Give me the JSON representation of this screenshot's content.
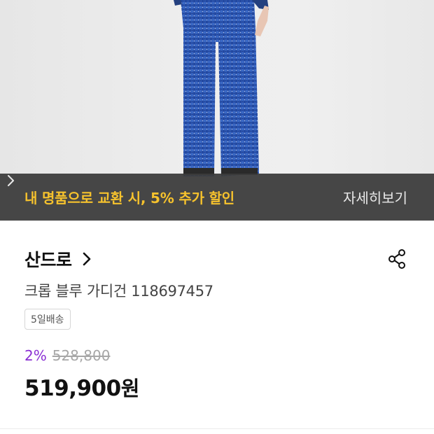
{
  "banner": {
    "promo_text": "내 명품으로 교환 시, 5% 추가 할인",
    "more_label": "자세히보기",
    "accent_color": "#f6c22d",
    "icon": "chevron-right-icon"
  },
  "product": {
    "brand": "산드로",
    "name": "크롭 블루 가디건 118697457",
    "shipping_badge": "5일배송",
    "discount_rate": "2%",
    "original_price": "528,800",
    "price": "519,900",
    "currency_suffix": "원",
    "discount_color": "#8a2fd3"
  },
  "icons": {
    "brand_chevron": "chevron-right-icon",
    "share": "share-icon"
  }
}
